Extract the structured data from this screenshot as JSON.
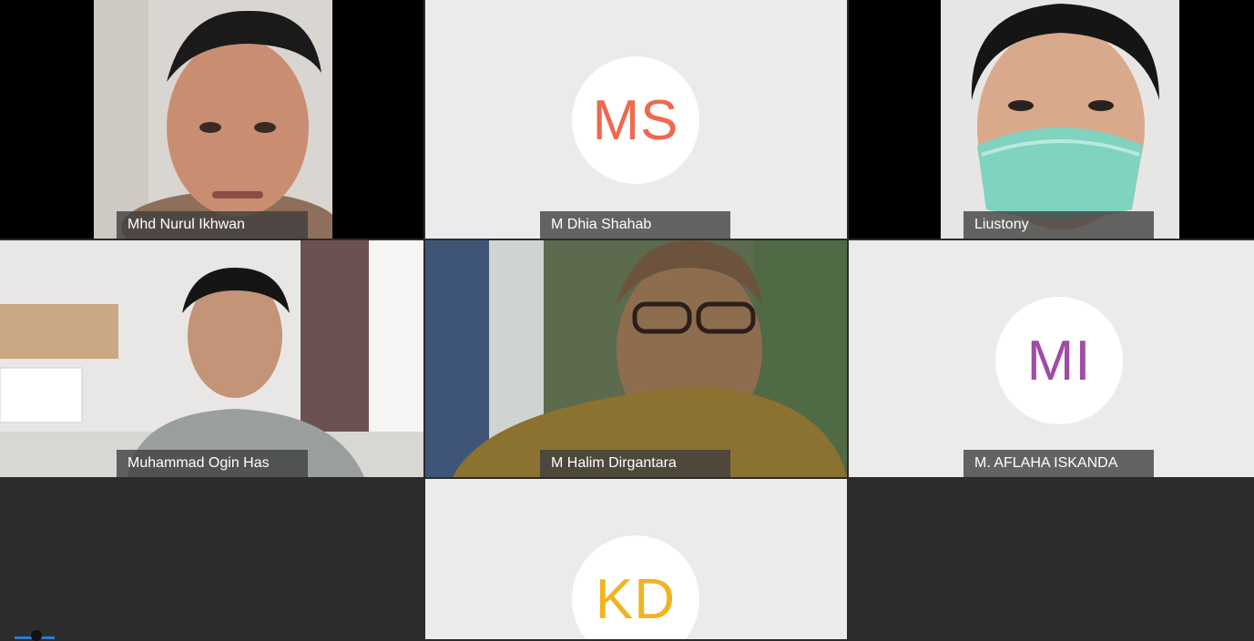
{
  "participants": [
    {
      "name": "Mhd Nurul Ikhwan",
      "type": "video"
    },
    {
      "name": "M Dhia Shahab",
      "type": "avatar",
      "initials": "MS",
      "color": "#f0684f"
    },
    {
      "name": "Liustony",
      "type": "video"
    },
    {
      "name": "Muhammad Ogin Has",
      "type": "video"
    },
    {
      "name": "M Halim Dirgantara",
      "type": "video"
    },
    {
      "name": "M. AFLAHA ISKANDA",
      "type": "avatar",
      "initials": "MI",
      "color": "#a04ba4"
    },
    {
      "name": "",
      "type": "empty"
    },
    {
      "name": "",
      "type": "avatar",
      "initials": "KD",
      "color": "#f2b320"
    },
    {
      "name": "",
      "type": "empty"
    }
  ]
}
